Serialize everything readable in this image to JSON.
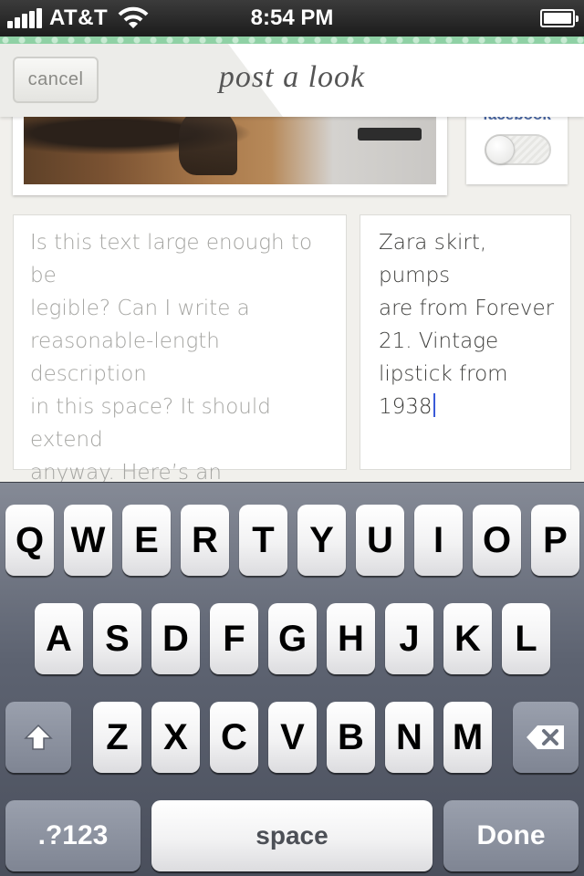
{
  "status_bar": {
    "carrier": "AT&T",
    "time": "8:54 PM",
    "icons": [
      "signal-icon",
      "wifi-icon",
      "battery-icon"
    ]
  },
  "nav": {
    "cancel_label": "cancel",
    "title": "post a look"
  },
  "facebook": {
    "label": "facebook",
    "toggle_on": false
  },
  "description": {
    "text": "Is this text large enough to be\nlegible?  Can I write a\nreasonable-length description\nin this space?  It should extend\nanyway.  Here’s an additional\nline to go roughly Twitter\nlength."
  },
  "caption": {
    "text": "Zara skirt, pumps\nare from Forever\n21.  Vintage\nlipstick from 1938"
  },
  "keyboard": {
    "row1": [
      "Q",
      "W",
      "E",
      "R",
      "T",
      "Y",
      "U",
      "I",
      "O",
      "P"
    ],
    "row2": [
      "A",
      "S",
      "D",
      "F",
      "G",
      "H",
      "J",
      "K",
      "L"
    ],
    "row3": [
      "Z",
      "X",
      "C",
      "V",
      "B",
      "N",
      "M"
    ],
    "numbers_label": ".?123",
    "space_label": "space",
    "done_label": "Done",
    "shift_icon": "shift-icon",
    "delete_icon": "delete-icon"
  },
  "colors": {
    "accent_green": "#8fd1a5",
    "caret_blue": "#3a5ad8",
    "facebook_blue": "#4a68a6"
  }
}
